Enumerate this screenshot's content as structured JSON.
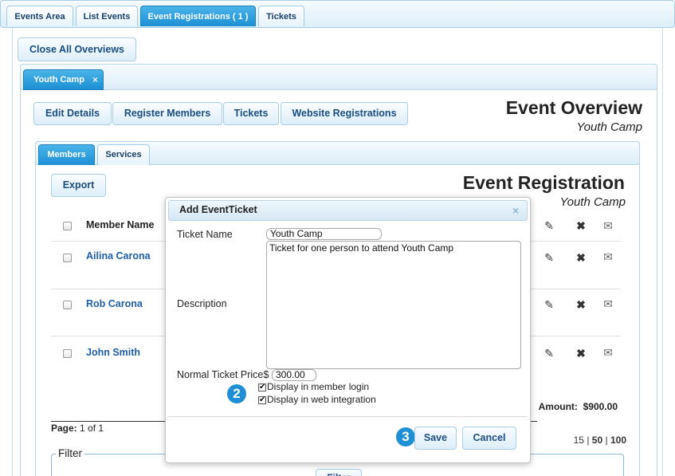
{
  "top_tabs": [
    {
      "label": "Events Area",
      "active": false
    },
    {
      "label": "List Events",
      "active": false
    },
    {
      "label": "Event Registrations ( 1 )",
      "active": true
    },
    {
      "label": "Tickets",
      "active": false
    }
  ],
  "close_all_label": "Close All Overviews",
  "event_tab": {
    "label": "Youth Camp",
    "close_glyph": "×"
  },
  "overview_buttons": [
    "Edit Details",
    "Register Members",
    "Tickets",
    "Website Registrations"
  ],
  "overview_title": "Event Overview",
  "overview_subtitle": "Youth Camp",
  "inner_tabs": [
    {
      "label": "Members",
      "active": true
    },
    {
      "label": "Services",
      "active": false
    }
  ],
  "export_label": "Export",
  "registration_title": "Event Registration",
  "registration_subtitle": "Youth Camp",
  "table": {
    "header": "Member Name",
    "rows": [
      "Ailina Carona",
      "Rob Carona",
      "John Smith"
    ]
  },
  "amount": {
    "label": "Amount:",
    "value": "$900.00"
  },
  "pager": {
    "label": "Page:",
    "value": "1 of 1",
    "sizes": [
      "15",
      "50",
      "100"
    ],
    "separator": "|"
  },
  "filter": {
    "legend": "Filter",
    "button": "Filter"
  },
  "modal": {
    "title": "Add EventTicket",
    "close_glyph": "×",
    "ticket_name_label": "Ticket Name",
    "ticket_name_value": "Youth Camp",
    "description_label": "Description",
    "description_value": "Ticket for one person to attend Youth Camp",
    "price_label": "Normal Ticket Price",
    "price_currency": "$",
    "price_value": "300.00",
    "checkbox_member_login": "Display in member login",
    "checkbox_web_integration": "Display in web integration",
    "save_label": "Save",
    "cancel_label": "Cancel"
  },
  "steps": {
    "checkboxes": "2",
    "save": "3"
  },
  "icons": {
    "edit": "pencil-icon",
    "delete": "close-icon",
    "email": "envelope-icon"
  },
  "colors": {
    "accent": "#1e8fd5",
    "link": "#1d5fa8",
    "tab_border": "#9fcbe5"
  }
}
